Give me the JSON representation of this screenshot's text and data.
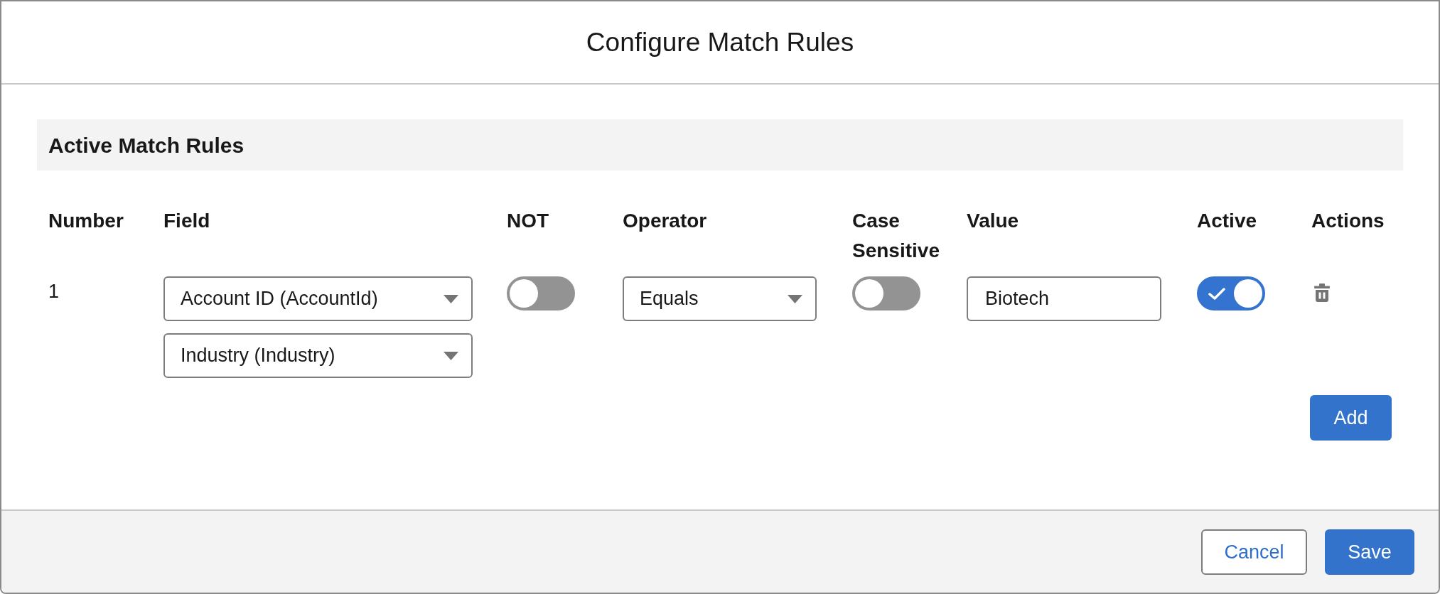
{
  "modal": {
    "title": "Configure Match Rules"
  },
  "section": {
    "title": "Active Match Rules"
  },
  "table": {
    "columns": [
      "Number",
      "Field",
      "NOT",
      "Operator",
      "Case Sensitive",
      "Value",
      "Active",
      "Actions"
    ],
    "rows": [
      {
        "number": "1",
        "fields": [
          "Account ID (AccountId)",
          "Industry (Industry)"
        ],
        "not": {
          "on": false
        },
        "operator": "Equals",
        "case_sensitive": {
          "on": false
        },
        "value": "Biotech",
        "active": {
          "on": true
        }
      }
    ]
  },
  "add_button": {
    "label": "Add"
  },
  "footer": {
    "buttons": [
      {
        "label": "Cancel",
        "kind": "secondary"
      },
      {
        "label": "Save",
        "kind": "primary"
      }
    ]
  }
}
